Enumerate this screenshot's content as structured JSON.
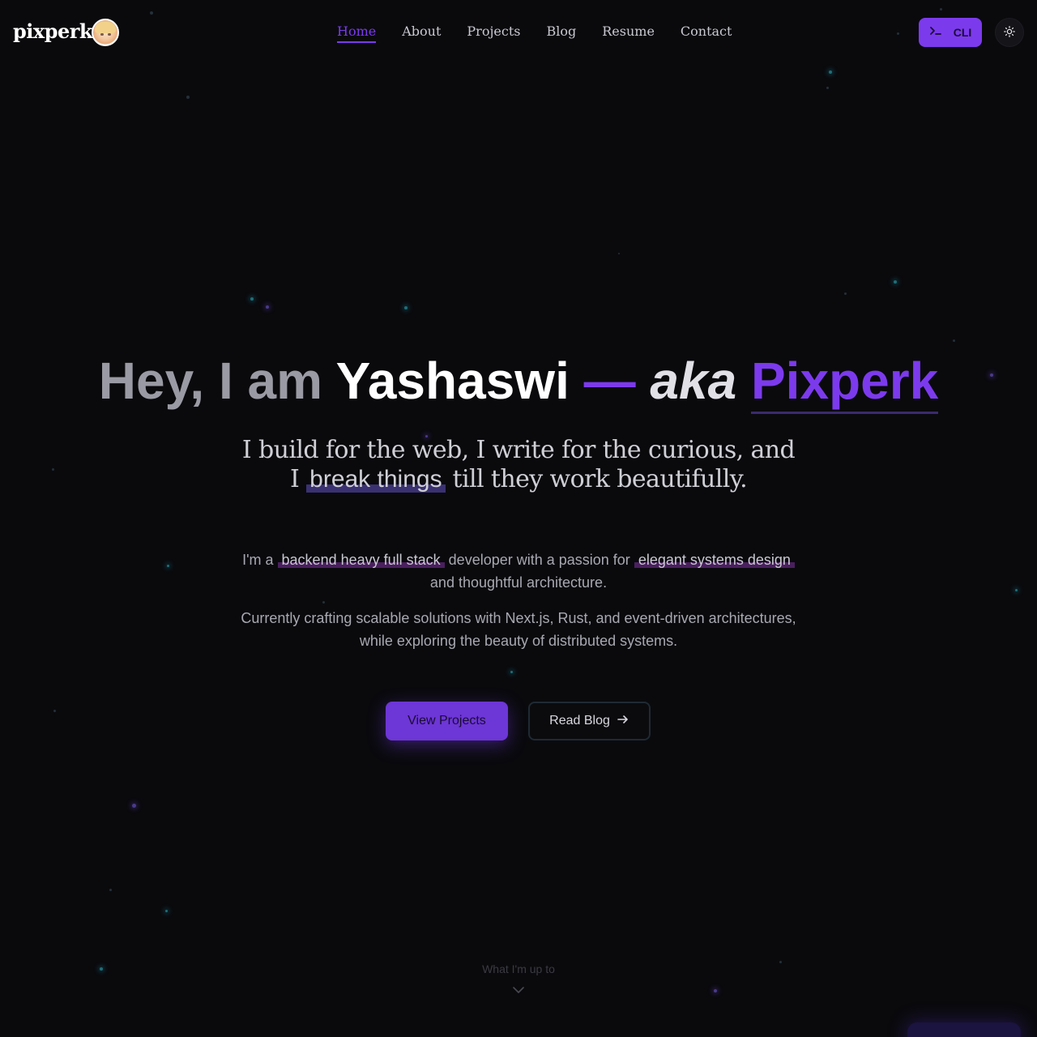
{
  "header": {
    "logo": "pixperk.",
    "avatar_icon": "avatar-icon",
    "nav": [
      {
        "label": "Home",
        "active": true
      },
      {
        "label": "About",
        "active": false
      },
      {
        "label": "Projects",
        "active": false
      },
      {
        "label": "Blog",
        "active": false
      },
      {
        "label": "Resume",
        "active": false
      },
      {
        "label": "Contact",
        "active": false
      }
    ],
    "cli_label": "CLI",
    "cli_icon": "terminal-icon",
    "theme_icon": "sun-icon"
  },
  "hero": {
    "greeting": "Hey, I am",
    "name": "Yashaswi",
    "dash": "—",
    "aka": "aka",
    "alias": "Pixperk",
    "tagline_start": "I build for the web, I write for the curious, and I",
    "tagline_highlight": "break things",
    "tagline_end": "till they work beautifully.",
    "desc1_start": "I'm a",
    "desc1_highlight1": "backend heavy full stack",
    "desc1_middle": "developer with a passion for",
    "desc1_highlight2": "elegant systems design",
    "desc1_end": "and thoughtful architecture.",
    "desc2": "Currently crafting scalable solutions with Next.js, Rust, and event-driven architectures, while exploring the beauty of distributed systems.",
    "primary_button": "View Projects",
    "secondary_button": "Read Blog",
    "secondary_icon": "arrow-right-icon"
  },
  "scroll": {
    "hint": "What I'm up to",
    "icon": "chevron-down-icon"
  },
  "colors": {
    "background": "#0a0a0d",
    "accent": "#7c3aed",
    "text": "#ffffff"
  }
}
